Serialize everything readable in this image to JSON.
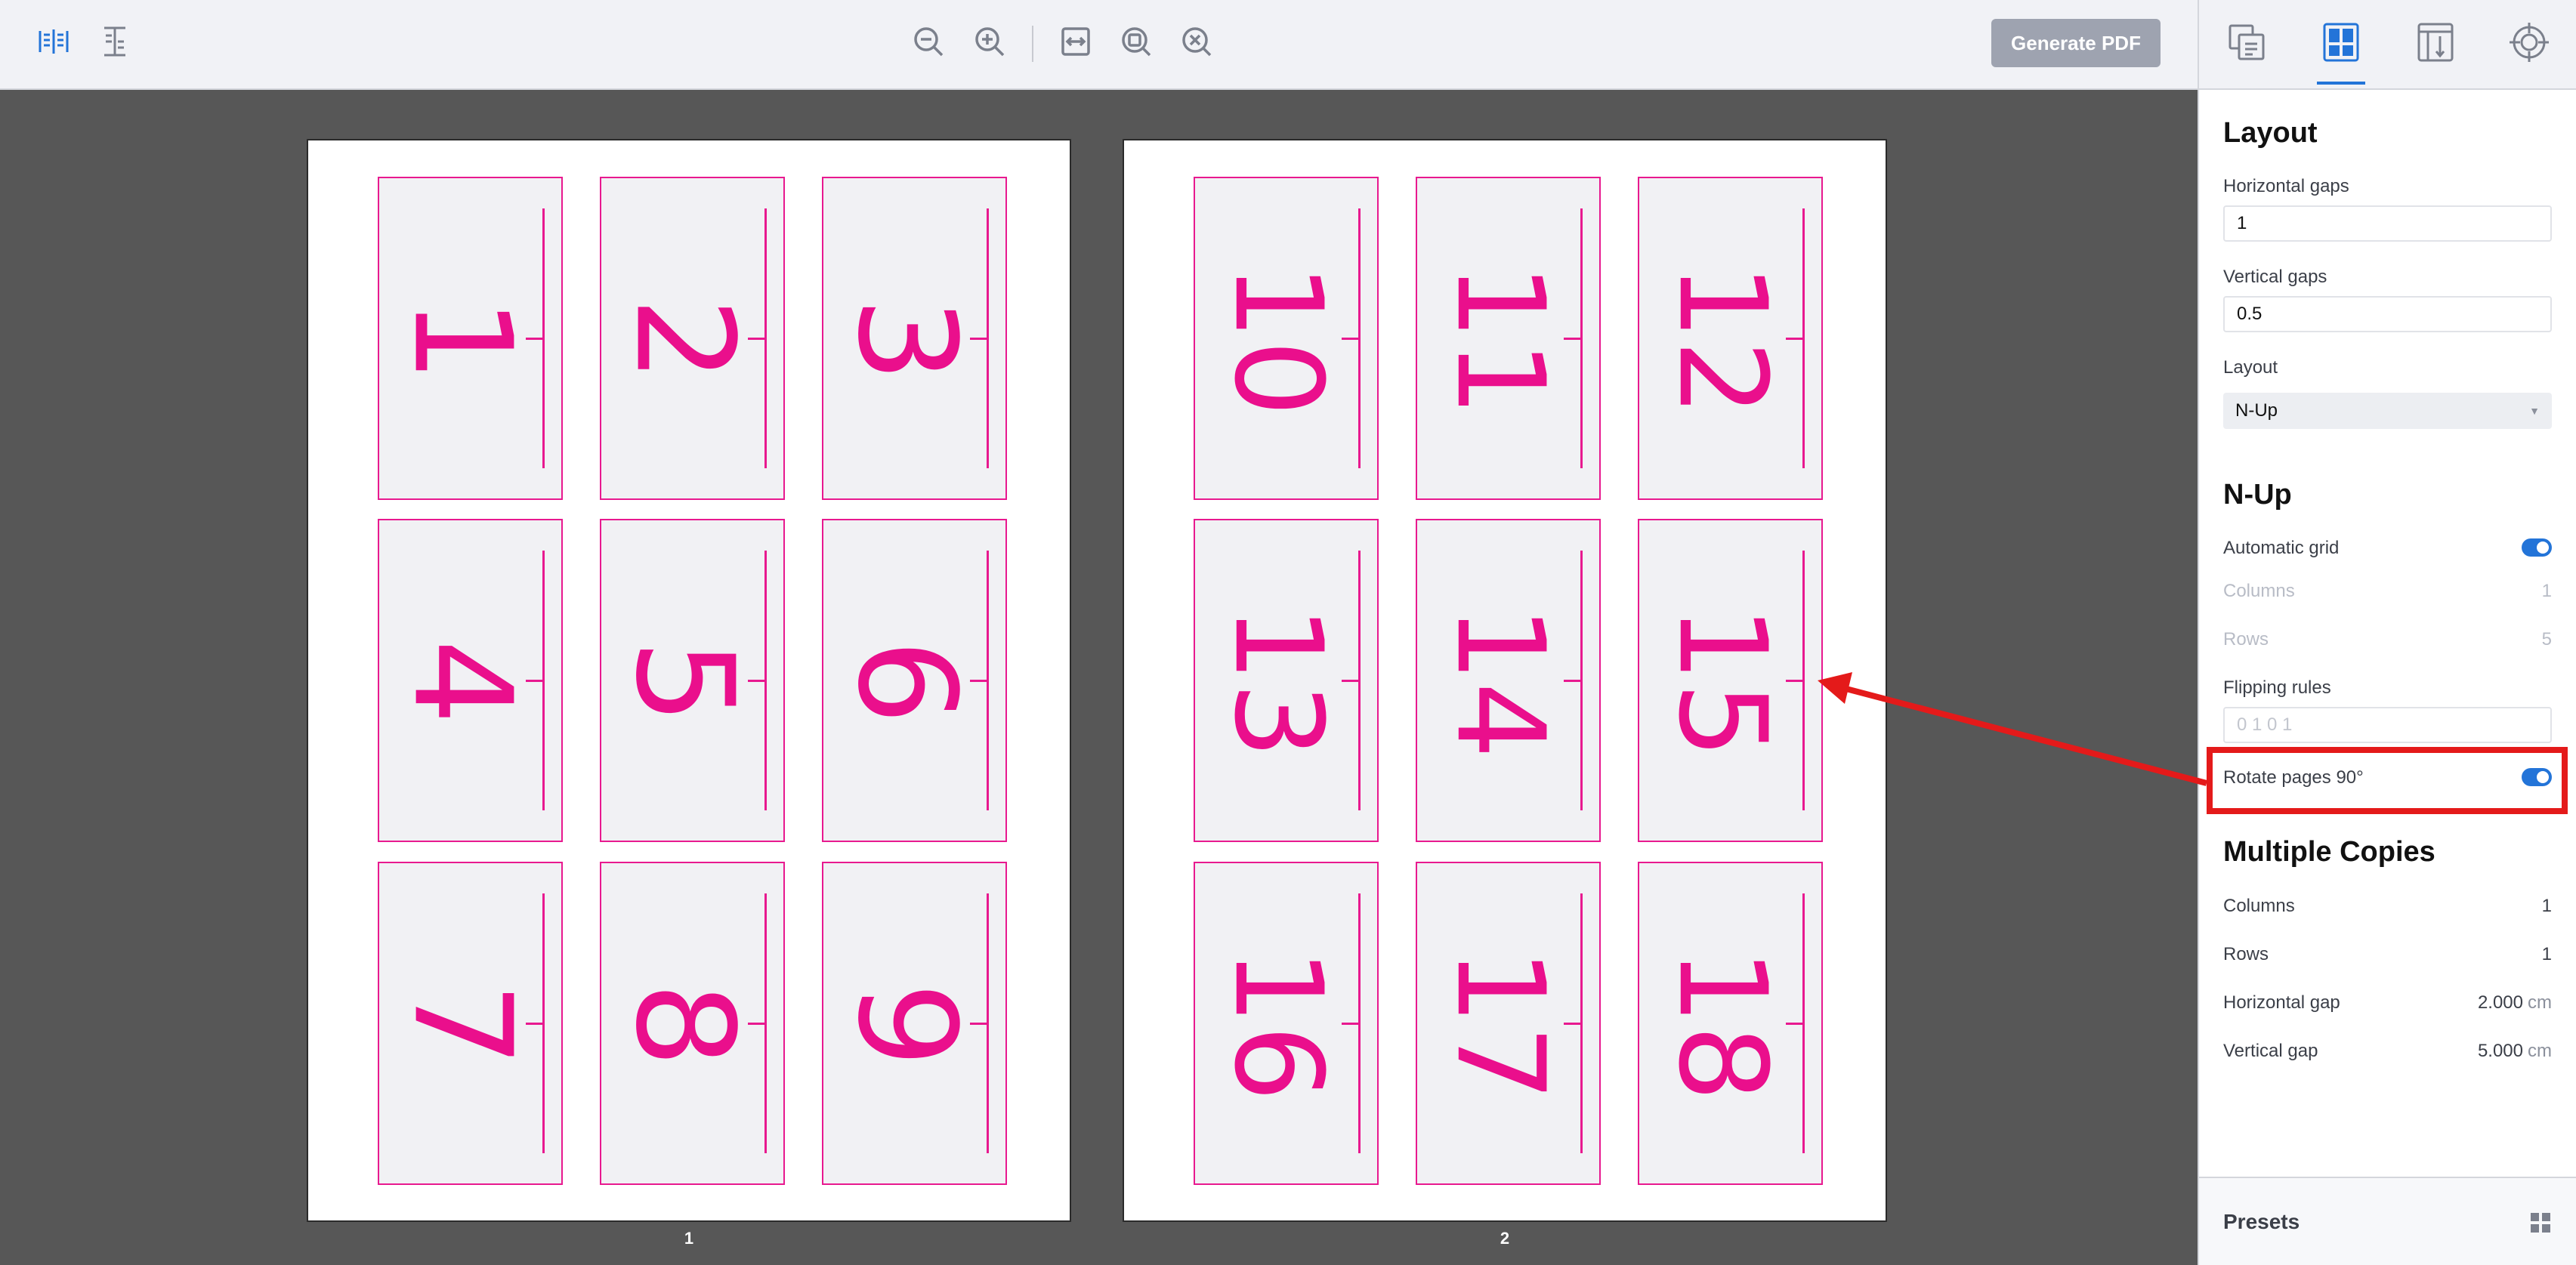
{
  "toolbar": {
    "icons": [
      "book-spread-icon",
      "ruler-marks-icon",
      "zoom-out-icon",
      "zoom-in-icon",
      "fit-width-icon",
      "zoom-fit-icon",
      "zoom-reset-icon"
    ],
    "generate_label": "Generate PDF"
  },
  "canvas": {
    "pages": [
      {
        "label": "1",
        "cells": [
          "1",
          "2",
          "3",
          "4",
          "5",
          "6",
          "7",
          "8",
          "9"
        ]
      },
      {
        "label": "2",
        "cells": [
          "10",
          "11",
          "12",
          "13",
          "14",
          "15",
          "16",
          "17",
          "18"
        ]
      }
    ],
    "cell_color": "#ea0f8c"
  },
  "panel": {
    "tabs": [
      "documents-icon",
      "layout-icon",
      "page-size-icon",
      "crosshair-icon"
    ],
    "active_tab": "layout-icon",
    "layout": {
      "title": "Layout",
      "horizontal_gaps_label": "Horizontal gaps",
      "horizontal_gaps_value": "1",
      "vertical_gaps_label": "Vertical gaps",
      "vertical_gaps_value": "0.5",
      "layout_label": "Layout",
      "layout_value": "N-Up"
    },
    "nup": {
      "title": "N-Up",
      "automatic_grid_label": "Automatic grid",
      "automatic_grid_on": true,
      "columns_label": "Columns",
      "columns_value": "1",
      "rows_label": "Rows",
      "rows_value": "5",
      "flipping_rules_label": "Flipping rules",
      "flipping_rules_placeholder": "0 1 0 1",
      "rotate_label": "Rotate pages 90°",
      "rotate_on": true
    },
    "copies": {
      "title": "Multiple Copies",
      "columns_label": "Columns",
      "columns_value": "1",
      "rows_label": "Rows",
      "rows_value": "1",
      "hgap_label": "Horizontal gap",
      "hgap_value": "2.000",
      "vgap_label": "Vertical gap",
      "vgap_value": "5.000",
      "unit": "cm"
    },
    "presets_label": "Presets"
  },
  "annotation_color": "#e41a1a"
}
